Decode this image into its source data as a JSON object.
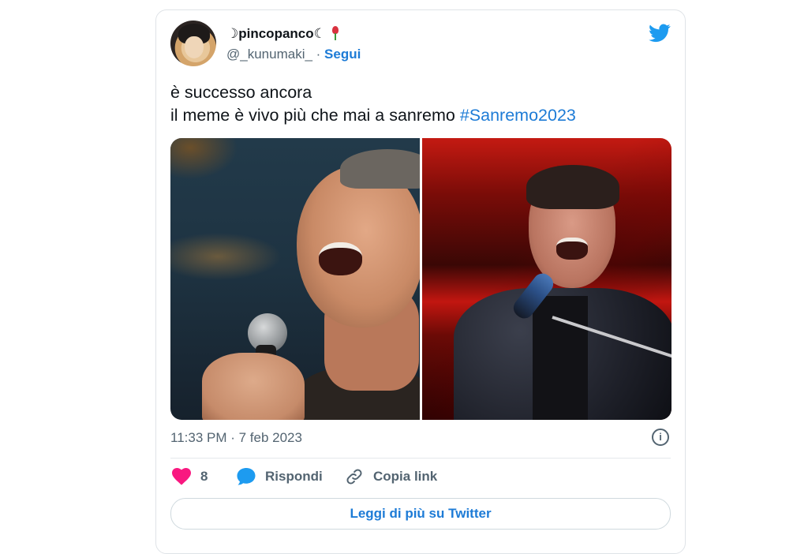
{
  "author": {
    "display_name": "☽pincopanco☾",
    "handle": "@_kunumaki_",
    "separator": " · ",
    "follow_label": "Segui"
  },
  "tweet": {
    "line1": "è successo ancora",
    "line2": "il meme è vivo più che mai a sanremo ",
    "hashtag": "#Sanremo2023"
  },
  "timestamp": "11:33 PM · 7 feb 2023",
  "actions": {
    "like_count": "8",
    "reply_label": "Rispondi",
    "copy_link_label": "Copia link"
  },
  "more_button_label": "Leggi di più su Twitter",
  "colors": {
    "accent": "#1d7bd6",
    "twitter_blue": "#1d9bf0",
    "like_pink": "#f91880",
    "secondary_text": "#536471"
  },
  "icons": [
    "twitter-bird-icon",
    "rose-emoji-icon",
    "info-icon",
    "heart-icon",
    "reply-bubble-icon",
    "link-icon"
  ]
}
